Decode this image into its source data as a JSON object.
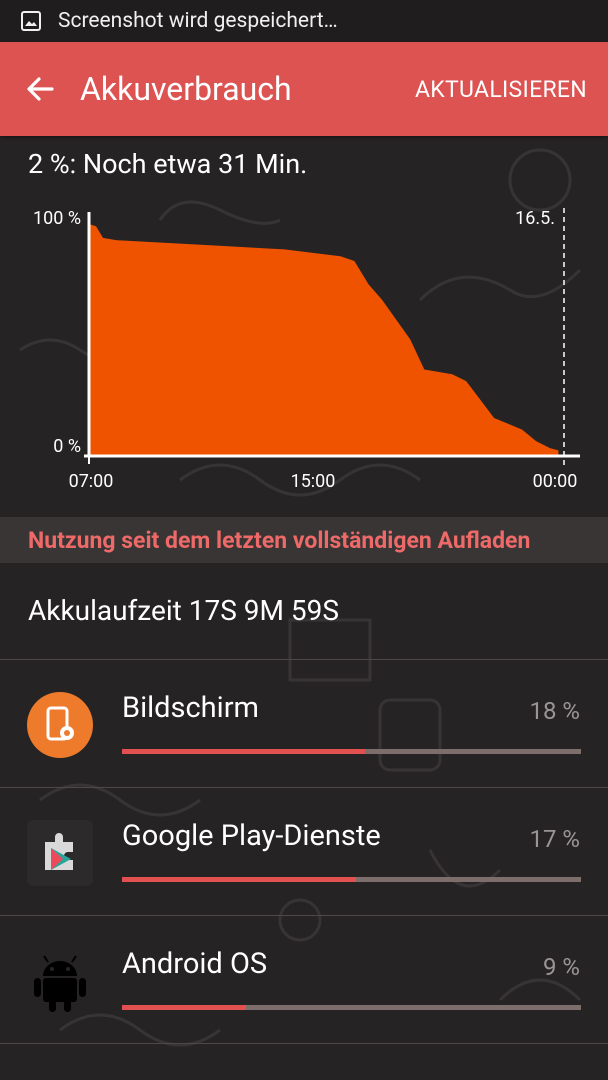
{
  "statusbar": {
    "notification": "Screenshot wird gespeichert…"
  },
  "appbar": {
    "title": "Akkuverbrauch",
    "action": "AKTUALISIEREN"
  },
  "battery": {
    "remaining": "2 %: Noch etwa 31 Min."
  },
  "chart_data": {
    "type": "area",
    "ylabel_top": "100 %",
    "ylabel_bottom": "0 %",
    "date_marker": "16.5.",
    "xticks": [
      "07:00",
      "15:00",
      "00:00"
    ],
    "ylim": [
      0,
      100
    ],
    "x_hours": [
      7.0,
      7.25,
      7.5,
      8.0,
      11.0,
      14.0,
      16.0,
      16.5,
      17.0,
      17.5,
      18.5,
      19.0,
      20.0,
      20.5,
      21.5,
      22.5,
      23.0,
      23.5,
      23.8
    ],
    "values": [
      100,
      99,
      94,
      93,
      91,
      89,
      86,
      84,
      74,
      67,
      50,
      37,
      35,
      32,
      16,
      11,
      6,
      3,
      2
    ],
    "fill_color": "#ef5300"
  },
  "usage": {
    "header": "Nutzung seit dem letzten vollständigen Aufladen",
    "runtime": "Akkulaufzeit 17S 9M 59S"
  },
  "apps": [
    {
      "name": "Bildschirm",
      "percent_label": "18 %",
      "fill_fraction": 0.53
    },
    {
      "name": "Google Play-Dienste",
      "percent_label": "17 %",
      "fill_fraction": 0.51
    },
    {
      "name": "Android OS",
      "percent_label": "9 %",
      "fill_fraction": 0.27
    }
  ]
}
